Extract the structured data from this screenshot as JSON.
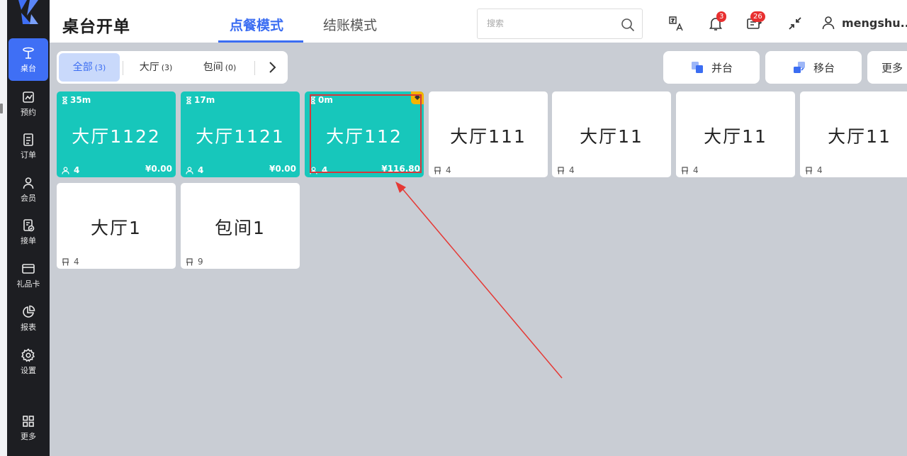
{
  "sidebar": {
    "items": [
      {
        "label": "桌台",
        "icon": "dining-table-icon"
      },
      {
        "label": "预约",
        "icon": "reservation-icon"
      },
      {
        "label": "订单",
        "icon": "order-icon"
      },
      {
        "label": "会员",
        "icon": "member-icon"
      },
      {
        "label": "接单",
        "icon": "receive-order-icon"
      },
      {
        "label": "礼品卡",
        "icon": "gift-card-icon"
      },
      {
        "label": "报表",
        "icon": "report-pie-icon"
      },
      {
        "label": "设置",
        "icon": "gear-icon"
      },
      {
        "label": "更多",
        "icon": "grid-more-icon"
      }
    ]
  },
  "header": {
    "title": "桌台开单",
    "tabs": [
      "点餐模式",
      "结账模式"
    ],
    "active_tab": "点餐模式",
    "search_placeholder": "搜索",
    "notification_count": "3",
    "message_count": "26",
    "username": "mengshu..."
  },
  "filters": [
    {
      "label": "全部",
      "count": "(3)",
      "active": true
    },
    {
      "label": "大厅",
      "count": "(3)",
      "active": false
    },
    {
      "label": "包间",
      "count": "(0)",
      "active": false
    }
  ],
  "actions": {
    "merge": "并台",
    "move": "移台",
    "more": "更多"
  },
  "tables": [
    {
      "name": "大厅1122",
      "seats": "4",
      "status": "occupied",
      "timer": "35m",
      "amount": "¥0.00"
    },
    {
      "name": "大厅1121",
      "seats": "4",
      "status": "occupied",
      "timer": "17m",
      "amount": "¥0.00"
    },
    {
      "name": "大厅112",
      "seats": "4",
      "status": "occupied",
      "timer": "0m",
      "amount": "¥116.80",
      "flagged": true
    },
    {
      "name": "大厅111",
      "seats": "4",
      "status": "free"
    },
    {
      "name": "大厅11",
      "seats": "4",
      "status": "free"
    },
    {
      "name": "大厅11",
      "seats": "4",
      "status": "free"
    },
    {
      "name": "大厅11",
      "seats": "4",
      "status": "free"
    },
    {
      "name": "大厅1",
      "seats": "4",
      "status": "free"
    },
    {
      "name": "包间1",
      "seats": "9",
      "status": "free"
    }
  ],
  "colors": {
    "accent": "#3b6df2",
    "occupied": "#17c7bb",
    "badge": "#e83030",
    "annotation": "#e53935"
  }
}
